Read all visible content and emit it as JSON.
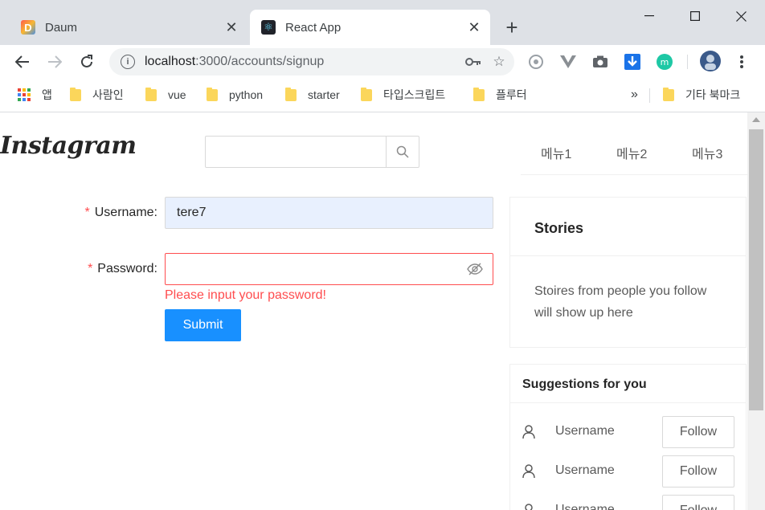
{
  "browser": {
    "tabs": [
      {
        "title": "Daum",
        "favicon_letter": "D",
        "active": false
      },
      {
        "title": "React App",
        "favicon_letter": "⚛",
        "active": true
      }
    ],
    "url_host": "localhost",
    "url_path": ":3000/accounts/signup",
    "bookmarks": {
      "apps": "앱",
      "items": [
        "사람인",
        "vue",
        "python",
        "starter",
        "타입스크립트",
        "플루터"
      ],
      "more": "»",
      "other": "기타 북마크"
    },
    "colors": {
      "frame": "#dee1e6",
      "accent": "#1a73e8"
    }
  },
  "header": {
    "logo": "Instagram",
    "search": {
      "placeholder": "",
      "value": ""
    },
    "menu": [
      "메뉴1",
      "메뉴2",
      "메뉴3"
    ]
  },
  "signup_form": {
    "username": {
      "label": "Username",
      "value": "tere7"
    },
    "password": {
      "label": "Password",
      "value": "",
      "error": "Please input your password!"
    },
    "submit_label": "Submit"
  },
  "sidebar": {
    "stories": {
      "title": "Stories",
      "body": "Stoires from people you follow will show up here"
    },
    "suggestions": {
      "title": "Suggestions for you",
      "items": [
        {
          "name": "Username",
          "action": "Follow"
        },
        {
          "name": "Username",
          "action": "Follow"
        },
        {
          "name": "Username",
          "action": "Follow"
        }
      ]
    }
  },
  "colors": {
    "primary": "#1890ff",
    "error": "#ff4d4f",
    "autofill": "#e8f0fe"
  }
}
